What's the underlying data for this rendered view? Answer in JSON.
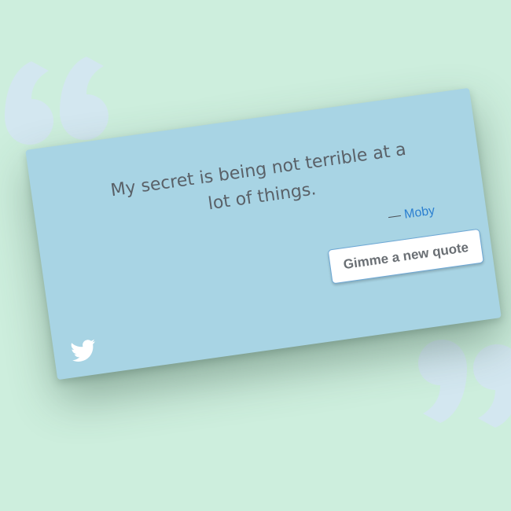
{
  "quote": {
    "text": "My secret is being not terrible at a lot of things.",
    "dash": "— ",
    "author": "Moby"
  },
  "actions": {
    "new_quote_label": "Gimme a new quote",
    "tweet_icon": "twitter-bird-icon"
  },
  "decorations": {
    "open_icon": "open-quote-icon",
    "close_icon": "close-quote-icon"
  },
  "colors": {
    "background": "#cdeedd",
    "card": "#a8d4e4",
    "quote_marks": "#d3e7f0",
    "author_link": "#2b7fd0",
    "quote_text": "#5a6168",
    "button_border": "#6ea8d6"
  }
}
